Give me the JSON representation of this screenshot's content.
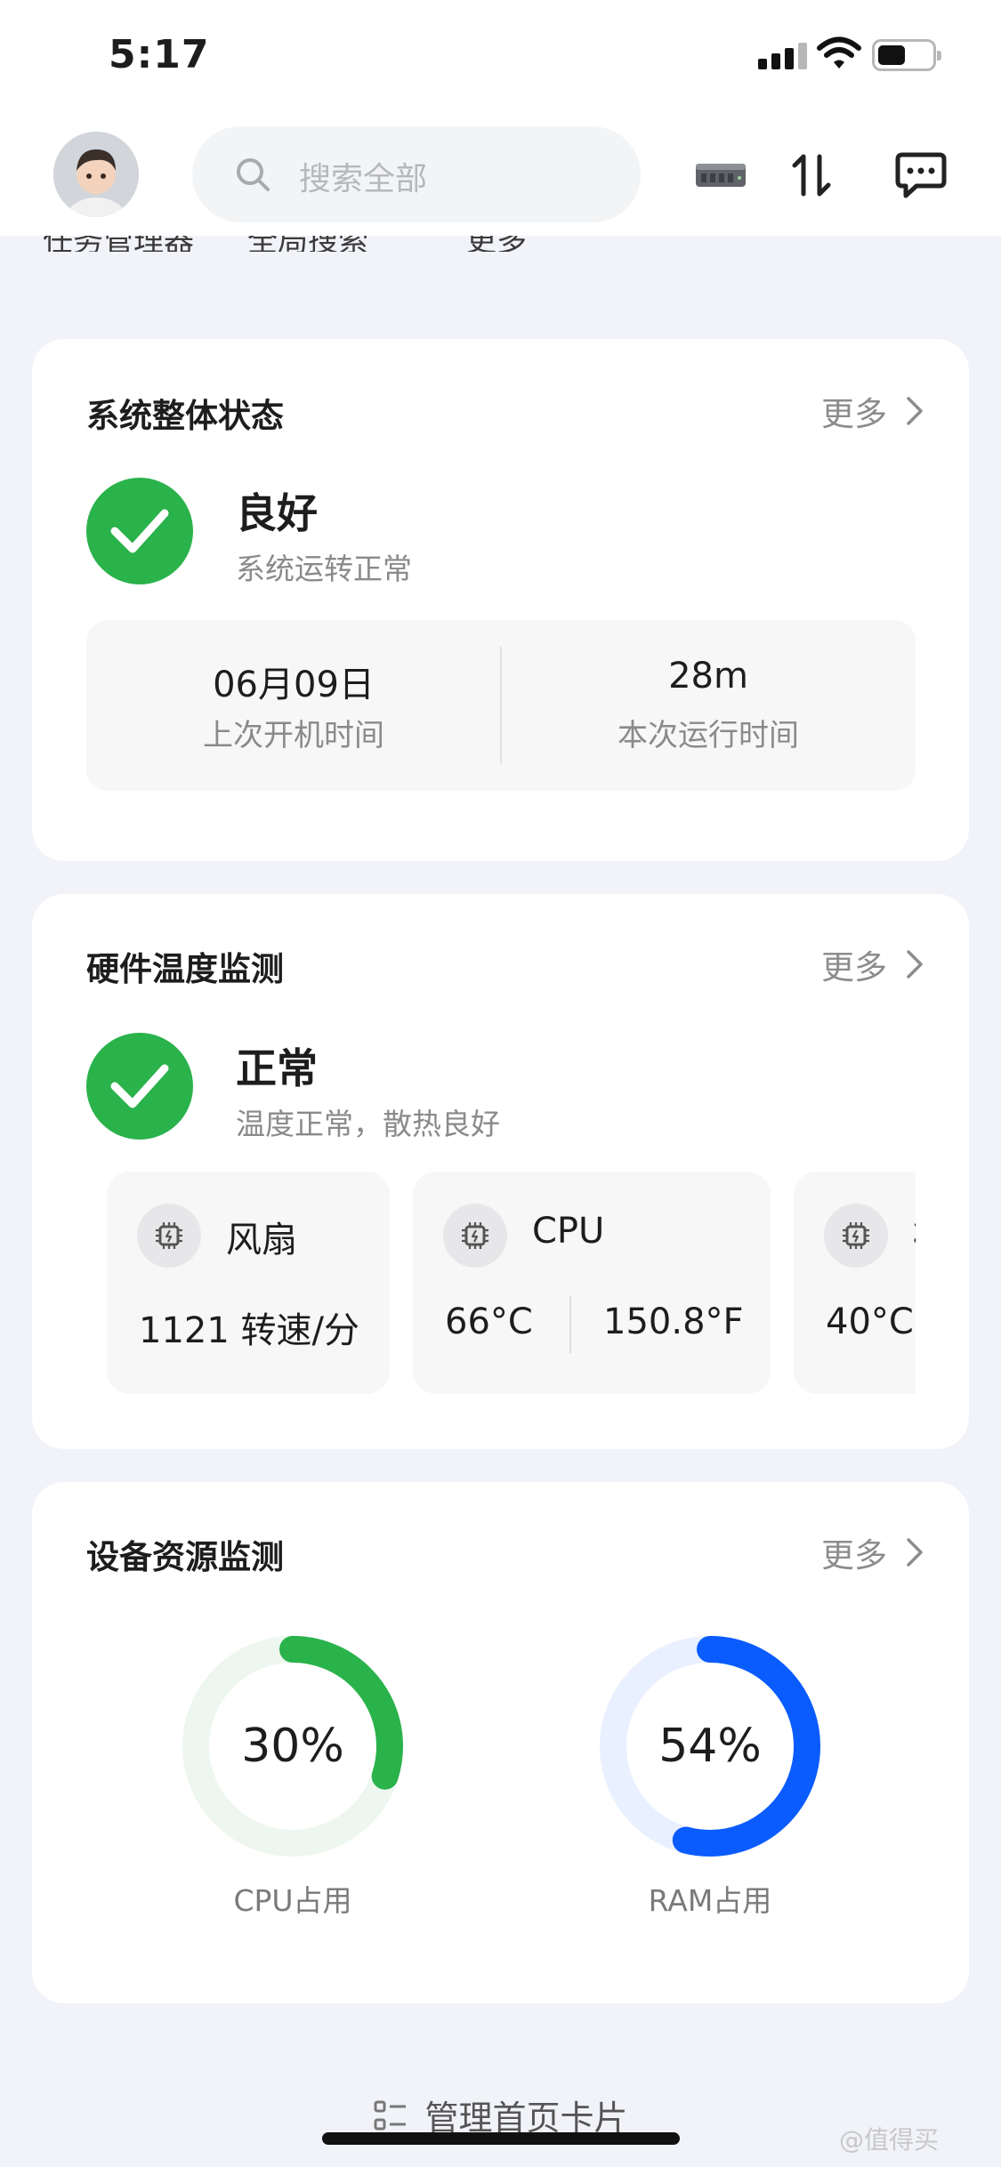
{
  "status_bar": {
    "time": "5:17"
  },
  "header": {
    "search_placeholder": "搜索全部",
    "icons": [
      "avatar",
      "search-icon",
      "nas-device-icon",
      "transfer-icon",
      "message-icon"
    ]
  },
  "peek_row": {
    "items": [
      "任务管理器",
      "全局搜索",
      "更多"
    ]
  },
  "system_card": {
    "title": "系统整体状态",
    "more": "更多",
    "status": "良好",
    "status_desc": "系统运转正常",
    "last_boot_value": "06月09日",
    "last_boot_label": "上次开机时间",
    "uptime_value": "28m",
    "uptime_label": "本次运行时间"
  },
  "temp_card": {
    "title": "硬件温度监测",
    "more": "更多",
    "status": "正常",
    "status_desc": "温度正常，散热良好",
    "items": [
      {
        "name": "风扇",
        "value": "1121 转速/分"
      },
      {
        "name": "CPU",
        "celsius": "66°C",
        "fahrenheit": "150.8°F"
      },
      {
        "name": "硬盘",
        "celsius": "40°C"
      }
    ]
  },
  "resource_card": {
    "title": "设备资源监测",
    "more": "更多",
    "cpu": {
      "percent": 30,
      "text": "30%",
      "label": "CPU占用"
    },
    "ram": {
      "percent": 54,
      "text": "54%",
      "label": "RAM占用"
    }
  },
  "footer": {
    "manage": "管理首页卡片",
    "watermark": "@值得买"
  },
  "colors": {
    "green": "#2ab24b",
    "green_track": "#edf7ef",
    "blue": "#0a5cff",
    "blue_track": "#e9f0ff",
    "background": "#f1f3f9"
  }
}
